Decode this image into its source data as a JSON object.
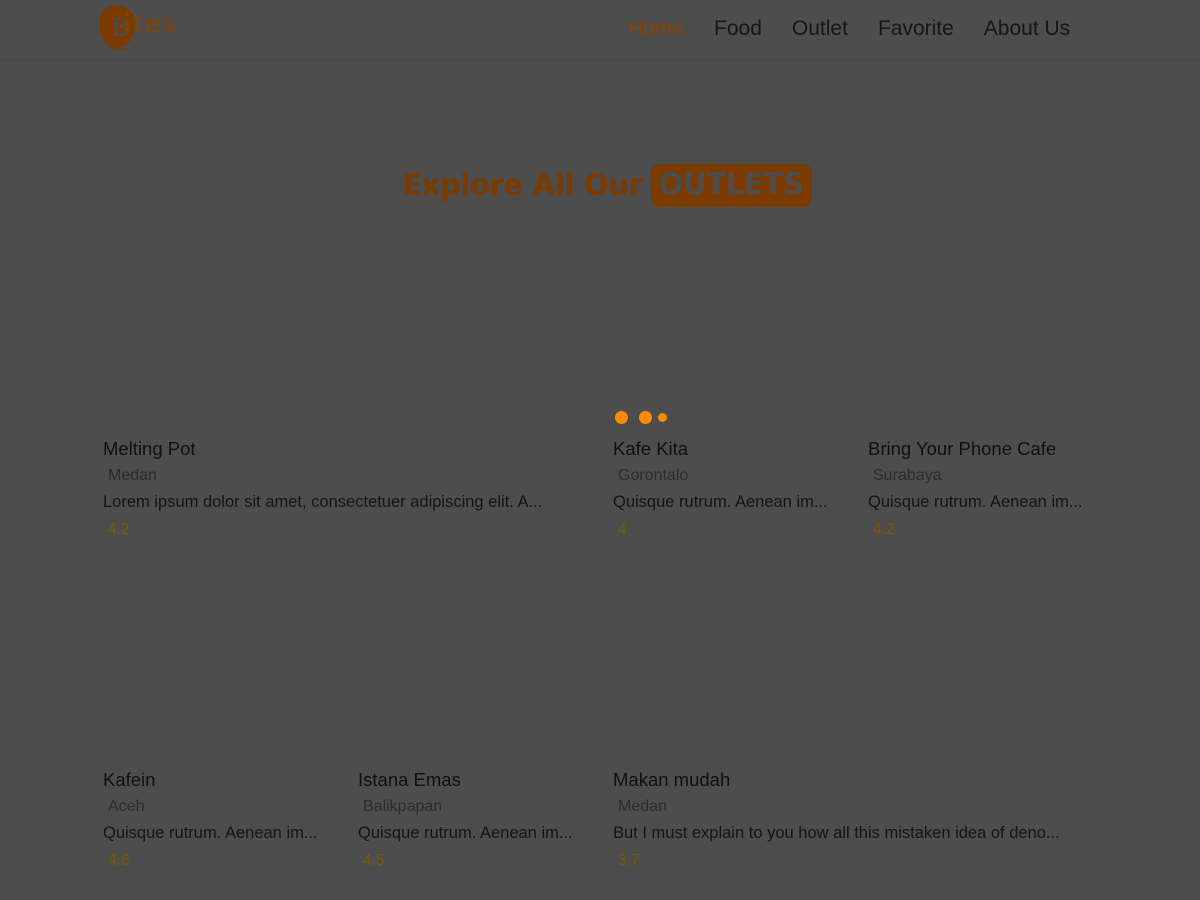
{
  "header": {
    "logo_text": "Bites",
    "logo_icon": "blob-logo-icon",
    "nav": [
      {
        "label": "Home",
        "active": true
      },
      {
        "label": "Food",
        "active": false
      },
      {
        "label": "Outlet",
        "active": false
      },
      {
        "label": "Favorite",
        "active": false
      },
      {
        "label": "About Us",
        "active": false
      }
    ]
  },
  "hero": {
    "title": "Explore All Our",
    "badge": "OUTLETS"
  },
  "loader": {
    "icon": "loading-dots-icon",
    "color": "#ff8a00"
  },
  "outlets": [
    {
      "name": "Melting Pot",
      "city": "Medan",
      "description": "Lorem ipsum dolor sit amet, consectetuer adipiscing elit. A...",
      "rating": "4.2"
    },
    {
      "name": "Kafe Kita",
      "city": "Gorontalo",
      "description": "Quisque rutrum. Aenean im...",
      "rating": "4"
    },
    {
      "name": "Bring Your Phone Cafe",
      "city": "Surabaya",
      "description": "Quisque rutrum. Aenean im...",
      "rating": "4.2"
    },
    {
      "name": "Kafein",
      "city": "Aceh",
      "description": "Quisque rutrum. Aenean im...",
      "rating": "4.6"
    },
    {
      "name": "Istana Emas",
      "city": "Balikpapan",
      "description": "Quisque rutrum. Aenean im...",
      "rating": "4.5"
    },
    {
      "name": "Makan mudah",
      "city": "Medan",
      "description": "But I must explain to you how all this mistaken idea of deno...",
      "rating": "3.7"
    }
  ],
  "colors": {
    "overlay_bg": "#4d4d4d",
    "accent": "#7a3a00",
    "loader": "#ff8a00"
  }
}
